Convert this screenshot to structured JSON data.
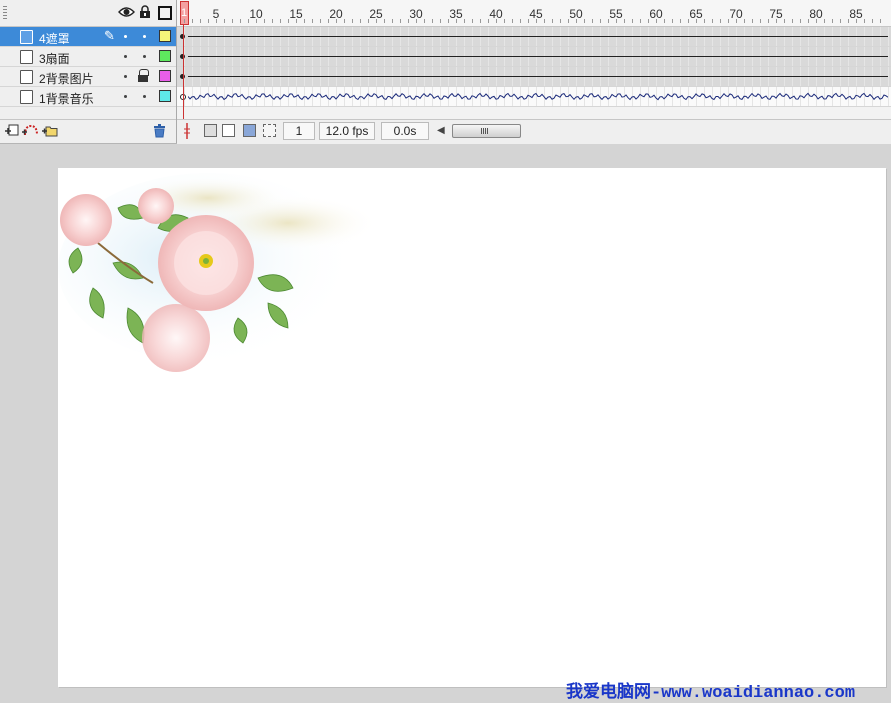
{
  "timeline": {
    "header_icons": [
      "eye-icon",
      "lock-icon",
      "outline-icon"
    ],
    "layers": [
      {
        "name": "4遮罩",
        "color": "#f4f47a",
        "selected": true,
        "locked": false,
        "editing": true
      },
      {
        "name": "3扇面",
        "color": "#5ee85e",
        "selected": false,
        "locked": false,
        "editing": false
      },
      {
        "name": "2背景图片",
        "color": "#e85ee8",
        "selected": false,
        "locked": true,
        "editing": false
      },
      {
        "name": "1背景音乐",
        "color": "#5ee8e8",
        "selected": false,
        "locked": false,
        "editing": false
      }
    ],
    "ruler_labels": [
      "1",
      "5",
      "10",
      "15",
      "20",
      "25",
      "30",
      "35",
      "40",
      "45",
      "50",
      "55",
      "60",
      "65",
      "70",
      "75",
      "80",
      "85"
    ],
    "current_frame": "1",
    "frame_rate": "12.0 fps",
    "elapsed_time": "0.0s",
    "layer_tool_icons": [
      "insert-layer-icon",
      "add-motion-guide-icon",
      "insert-layer-folder-icon",
      "delete-layer-icon"
    ],
    "frame_control_icons": [
      "center-frame-icon",
      "onion-skin-icon",
      "onion-skin-outlines-icon",
      "edit-multiple-frames-icon",
      "modify-onion-markers-icon"
    ]
  },
  "watermark": "我爱电脑网-www.woaidiannao.com",
  "colors": {
    "selected_layer": "#3d8ad8",
    "playhead": "#cc3333",
    "watermark": "#1a37c9"
  }
}
